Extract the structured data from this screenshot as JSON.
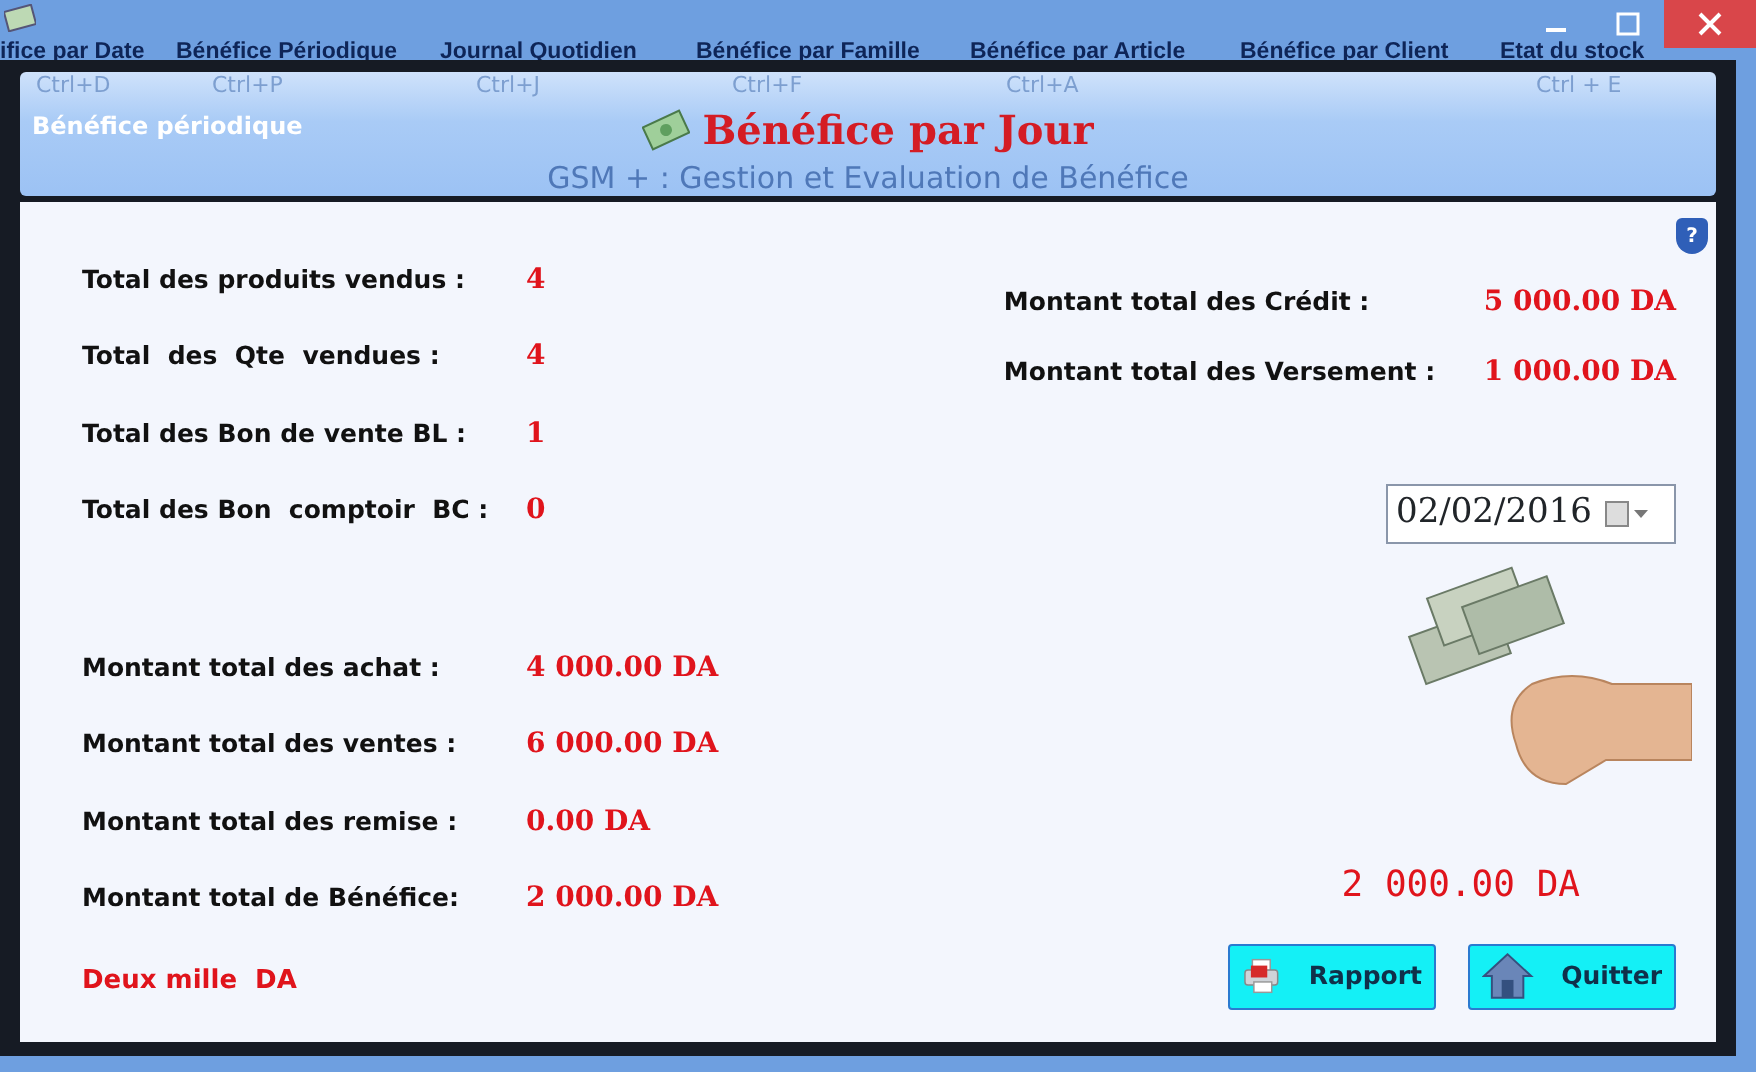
{
  "toolbar": [
    {
      "label": "ifice par Date",
      "shortcut": "Ctrl+D"
    },
    {
      "label": "Bénéfice Périodique",
      "shortcut": "Ctrl+P"
    },
    {
      "label": "Journal Quotidien",
      "shortcut": "Ctrl+J"
    },
    {
      "label": "Bénéfice par Famille",
      "shortcut": "Ctrl+F"
    },
    {
      "label": "Bénéfice par Article",
      "shortcut": "Ctrl+A"
    },
    {
      "label": "Bénéfice par Client"
    },
    {
      "label": "Etat du stock",
      "shortcut": "Ctrl + E"
    }
  ],
  "background_menu": "Bénéfice périodique",
  "background_title": "GSM + : Gestion et Evaluation de Bénéfice",
  "dialog": {
    "title": "Bénéfice par Jour",
    "counts": [
      {
        "label": "Total des produits vendus :",
        "value": "4"
      },
      {
        "label": "Total  des  Qte  vendues :",
        "value": "4"
      },
      {
        "label": "Total des Bon de vente BL :",
        "value": "1"
      },
      {
        "label": "Total des Bon  comptoir  BC :",
        "value": "0"
      }
    ],
    "amounts": [
      {
        "label": "Montant total des achat :",
        "value": "4 000.00 DA"
      },
      {
        "label": "Montant total des ventes :",
        "value": "6 000.00 DA"
      },
      {
        "label": "Montant total des remise :",
        "value": "0.00 DA"
      },
      {
        "label": "Montant total de Bénéfice:",
        "value": "2 000.00 DA"
      }
    ],
    "amount_in_words": "Deux mille  DA",
    "credit": [
      {
        "label": "Montant total des Crédit :",
        "value": "5 000.00 DA"
      },
      {
        "label": "Montant total des Versement :",
        "value": "1 000.00 DA"
      }
    ],
    "date": "02/02/2016",
    "help": "?",
    "digital_total": "2 000.00 DA",
    "buttons": [
      {
        "kind": "report",
        "label": "Rapport"
      },
      {
        "kind": "quit",
        "label": "Quitter"
      }
    ]
  }
}
